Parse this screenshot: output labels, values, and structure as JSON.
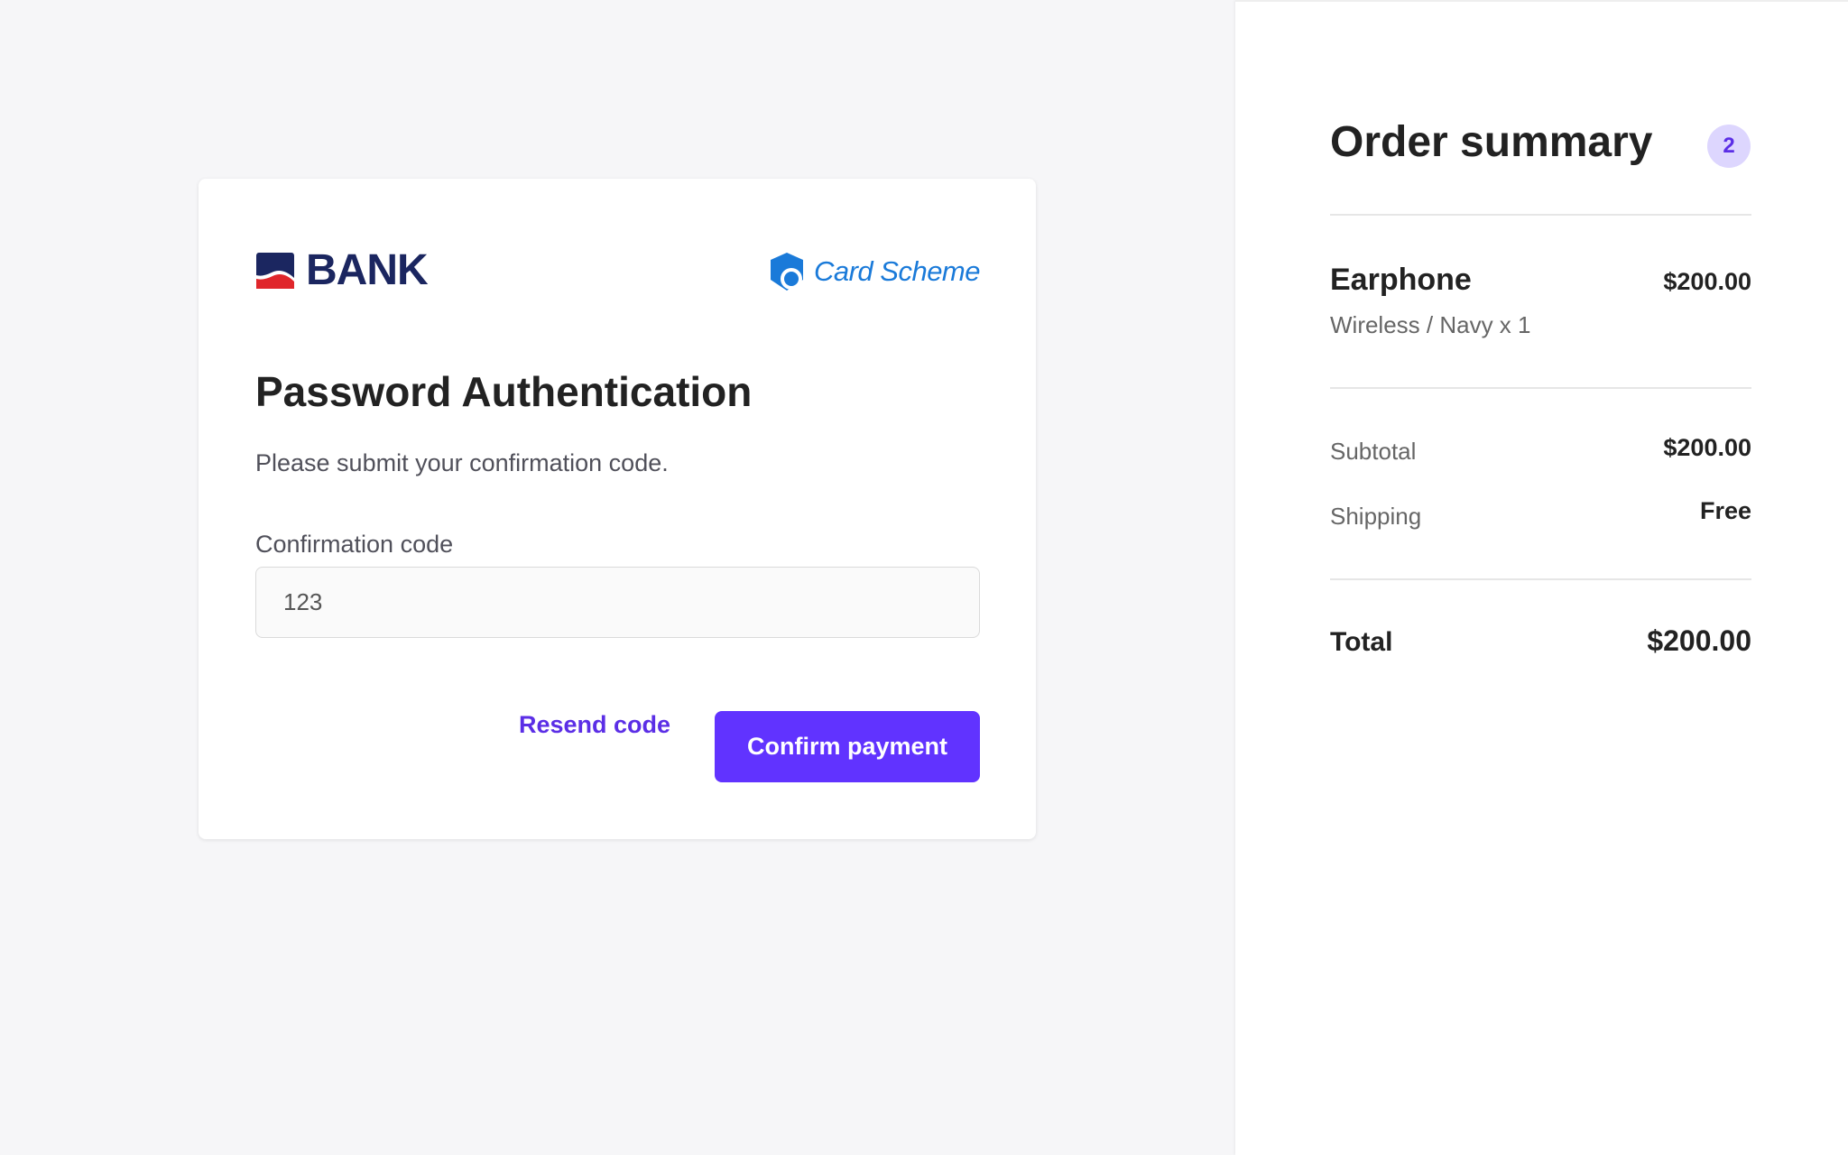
{
  "auth": {
    "bank_name": "BANK",
    "scheme_name": "Card Scheme",
    "title": "Password Authentication",
    "instructions": "Please submit your confirmation code.",
    "field_label": "Confirmation code",
    "code_value": "123",
    "resend_label": "Resend code",
    "confirm_label": "Confirm payment"
  },
  "summary": {
    "title": "Order summary",
    "item_count": "2",
    "item": {
      "name": "Earphone",
      "variant": "Wireless / Navy x 1",
      "price": "$200.00"
    },
    "subtotal_label": "Subtotal",
    "subtotal_value": "$200.00",
    "shipping_label": "Shipping",
    "shipping_value": "Free",
    "total_label": "Total",
    "total_value": "$200.00"
  },
  "colors": {
    "accent": "#6133ff",
    "bank_navy": "#1b2660",
    "bank_red": "#e0262b",
    "scheme_blue": "#1a7ad9",
    "background": "#f6f6f8"
  },
  "icons": [
    "bank-logo-icon",
    "card-scheme-logo-icon"
  ]
}
